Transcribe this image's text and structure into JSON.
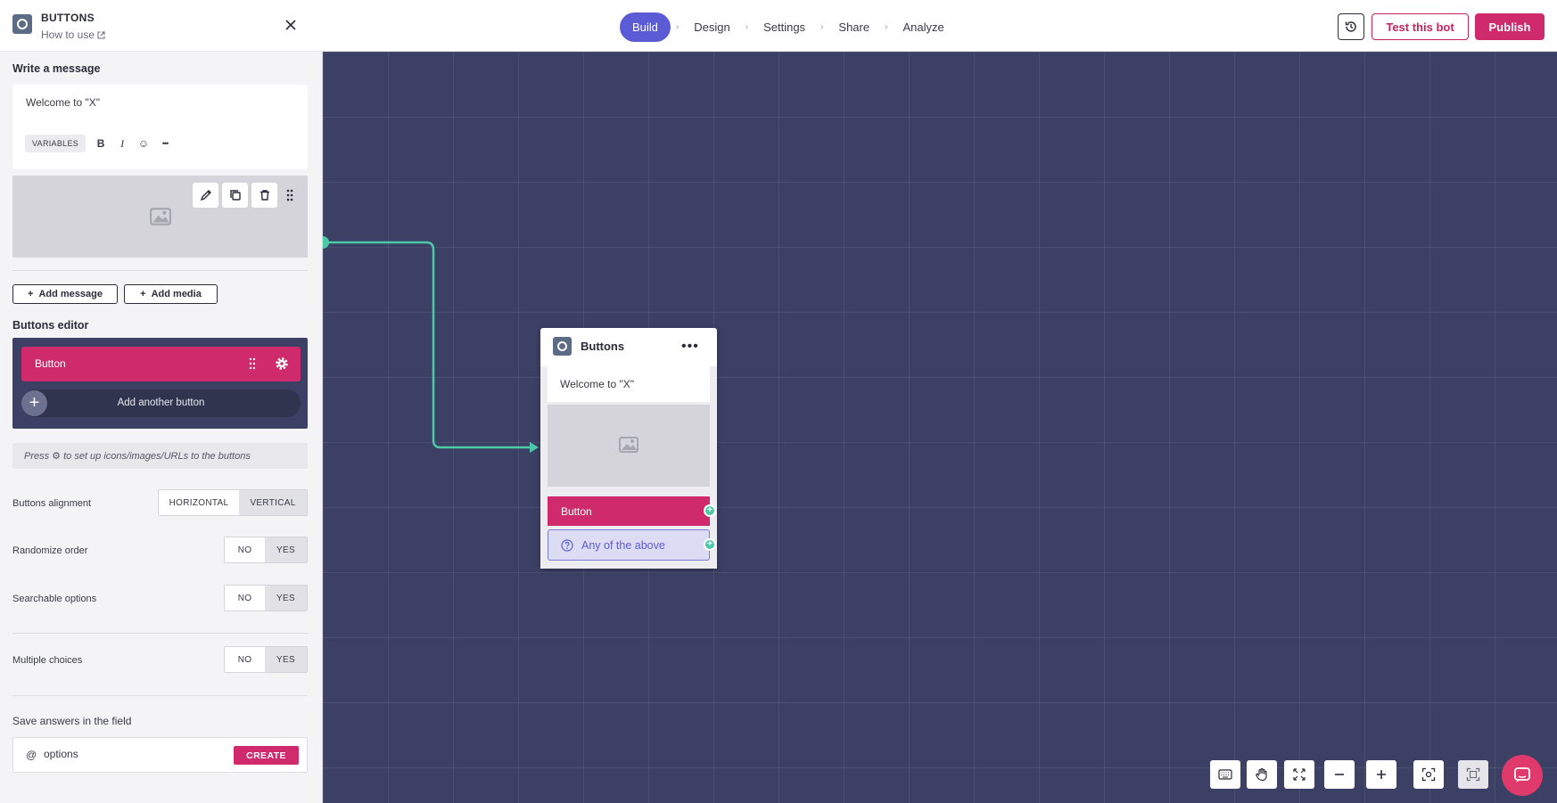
{
  "topbar": {
    "steps": [
      {
        "label": "Build"
      },
      {
        "label": "Design"
      },
      {
        "label": "Settings"
      },
      {
        "label": "Share"
      },
      {
        "label": "Analyze"
      }
    ],
    "separator": "›",
    "test_label": "Test this bot",
    "publish_label": "Publish"
  },
  "panel": {
    "title": "BUTTONS",
    "how_to_use": "How to use",
    "write_message_label": "Write a message",
    "message_text": "Welcome to \"X\"",
    "variables_label": "VARIABLES",
    "bold": "B",
    "italic": "I",
    "emoji": "☺",
    "more": "•••",
    "add_message_label": "Add message",
    "add_media_label": "Add media",
    "buttons_editor_label": "Buttons editor",
    "button_label": "Button",
    "add_another_label": "Add another button",
    "hint_text": "Press ⚙ to set up icons/images/URLs to the buttons",
    "alignment": {
      "label": "Buttons alignment",
      "options": [
        "HORIZONTAL",
        "VERTICAL"
      ],
      "selected": "HORIZONTAL"
    },
    "randomize": {
      "label": "Randomize order",
      "options": [
        "NO",
        "YES"
      ],
      "selected": "NO"
    },
    "searchable": {
      "label": "Searchable options",
      "options": [
        "NO",
        "YES"
      ],
      "selected": "NO"
    },
    "multiple": {
      "label": "Multiple choices",
      "options": [
        "NO",
        "YES"
      ],
      "selected": "NO"
    },
    "save_field_label": "Save answers in the field",
    "field_prefix": "@",
    "field_value": "options",
    "create_label": "CREATE"
  },
  "node": {
    "title": "Buttons",
    "more": "•••",
    "message": "Welcome to \"X\"",
    "button_label": "Button",
    "fallback_label": "Any of the above"
  },
  "colors": {
    "accent": "#5b5bd6",
    "brand": "#cf2a6b",
    "canvas": "#3b4064",
    "connector": "#4cc9a6"
  }
}
